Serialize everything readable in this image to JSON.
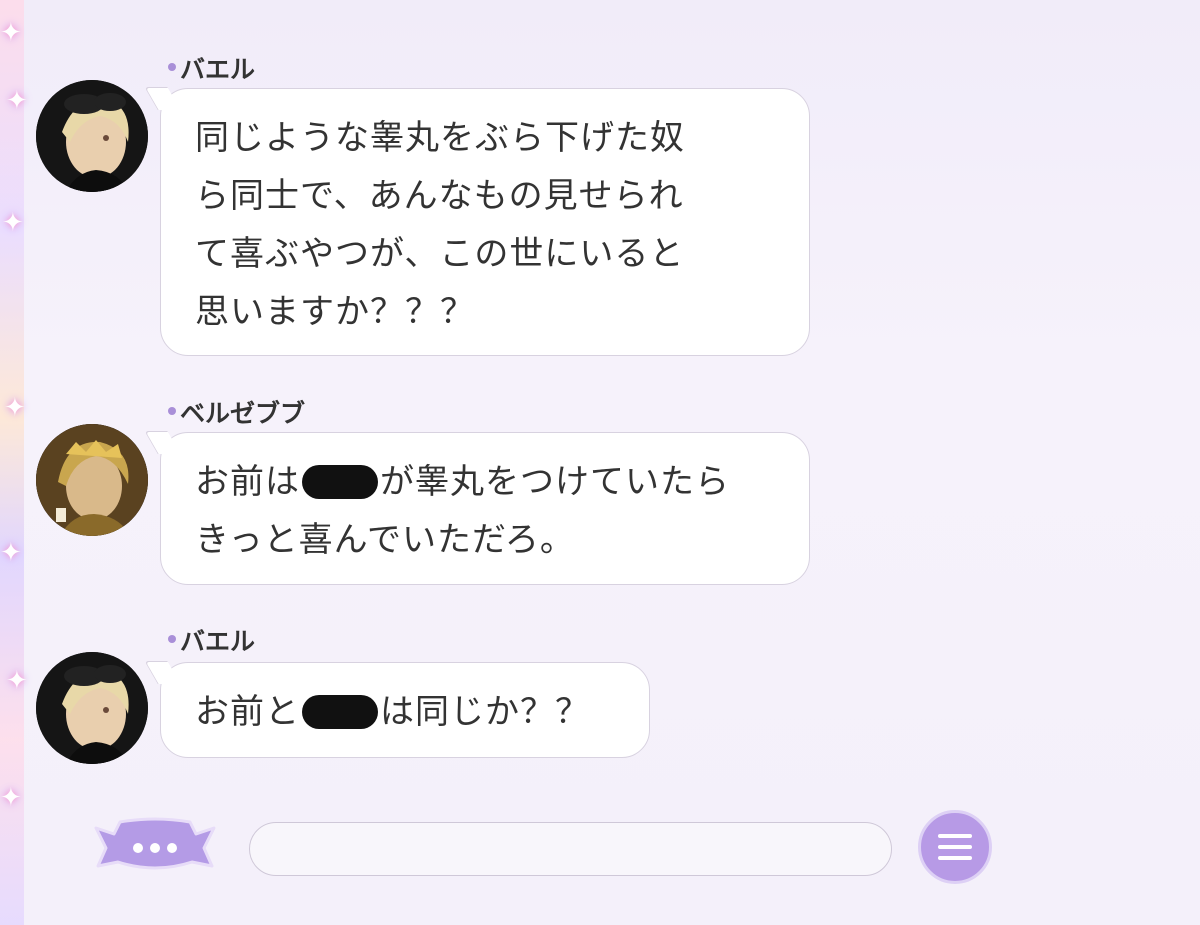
{
  "messages": [
    {
      "sender": "バエル",
      "lines": [
        "同じような睾丸をぶら下げた奴",
        "ら同士で、あんなもの見せられ",
        "て喜ぶやつが、この世にいると",
        "思いますか？？？"
      ]
    },
    {
      "sender": "ベルゼブブ",
      "line1_pre": "お前は",
      "line1_post": "が睾丸をつけていたら",
      "line2": "きっと喜んでいただろ。"
    },
    {
      "sender": "バエル",
      "line1_pre": "お前と",
      "line1_post": "は同じか？？"
    }
  ],
  "input": {
    "value": "",
    "placeholder": ""
  },
  "icons": {
    "more": "speech-bubble-dots-icon",
    "menu": "hamburger-menu-icon"
  },
  "colors": {
    "accent": "#b79ae6",
    "bubble": "#ffffff",
    "background": "#f3effa"
  }
}
